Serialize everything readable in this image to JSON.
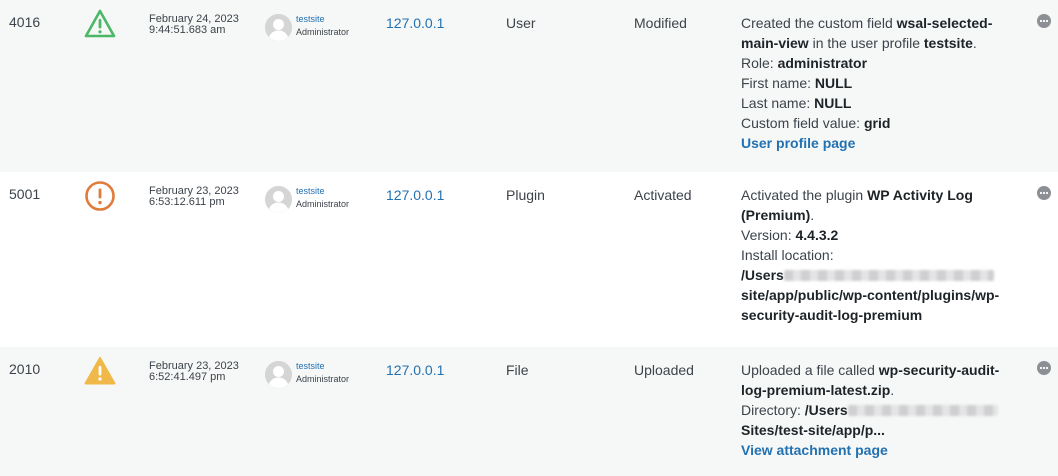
{
  "rows": [
    {
      "id": "4016",
      "severity": "warning-triangle-icon",
      "severity_color": "#4ab866",
      "date": "February 24, 2023",
      "time": "9:44:51.683 am",
      "user": "testsite",
      "role": "Administrator",
      "ip": "127.0.0.1",
      "object": "User",
      "event": "Modified",
      "message": {
        "l1a": "Created the custom field ",
        "l1b": "wsal-selected-main-view",
        "l1c": " in the user profile ",
        "l1d": "testsite",
        "l1e": ".",
        "role_label": "Role: ",
        "role_value": "administrator",
        "first_label": "First name: ",
        "first_value": "NULL",
        "last_label": "Last name: ",
        "last_value": "NULL",
        "custom_label": "Custom field value: ",
        "custom_value": "grid",
        "link": "User profile page"
      }
    },
    {
      "id": "5001",
      "severity": "alert-circle-icon",
      "severity_color": "#e07b39",
      "date": "February 23, 2023",
      "time": "6:53:12.611 pm",
      "user": "testsite",
      "role": "Administrator",
      "ip": "127.0.0.1",
      "object": "Plugin",
      "event": "Activated",
      "message": {
        "l1a": "Activated the plugin ",
        "l1b": "WP Activity Log (Premium)",
        "l1c": ".",
        "version_label": "Version: ",
        "version_value": "4.4.3.2",
        "install_label": "Install location:",
        "path_a": "/Users",
        "path_b": "site/app/public/wp-content/plugins/wp-security-audit-log-premium"
      }
    },
    {
      "id": "2010",
      "severity": "warning-filled-triangle-icon",
      "severity_color": "#f0b849",
      "date": "February 23, 2023",
      "time": "6:52:41.497 pm",
      "user": "testsite",
      "role": "Administrator",
      "ip": "127.0.0.1",
      "object": "File",
      "event": "Uploaded",
      "message": {
        "l1a": "Uploaded a file called ",
        "l1b": "wp-security-audit-log-premium-latest.zip",
        "l1c": ".",
        "dir_label": "Directory: ",
        "dir_a": "/Users",
        "dir_b": "Sites/test-site/app/p...",
        "link": "View attachment page"
      }
    }
  ]
}
